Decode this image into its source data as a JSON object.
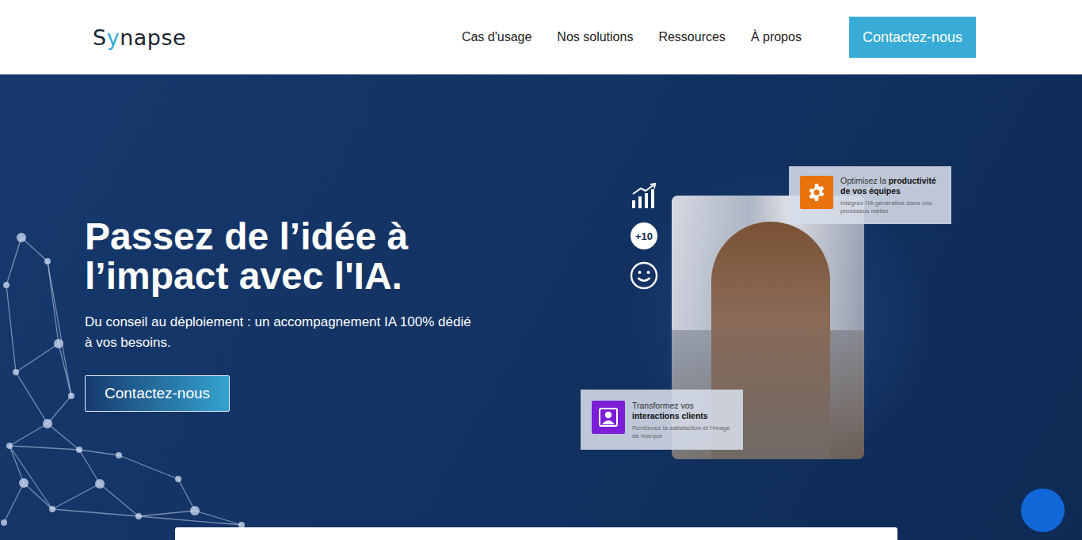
{
  "header": {
    "logo": "Synapse",
    "nav": [
      {
        "label": "Cas d'usage"
      },
      {
        "label": "Nos solutions"
      },
      {
        "label": "Ressources"
      },
      {
        "label": "À propos"
      }
    ],
    "cta": "Contactez-nous"
  },
  "hero": {
    "title_lines": [
      "Passez de l’idée à",
      "l’impact avec l'IA."
    ],
    "subtitle": "Du conseil au déploiement : un accompagnement IA 100% dédié à vos besoins.",
    "cta": "Contactez-nous"
  },
  "visual": {
    "side_icons": [
      {
        "kind": "chart"
      },
      {
        "kind": "badge",
        "text": "+10"
      },
      {
        "kind": "smiley"
      }
    ],
    "cards": [
      {
        "kind": "gear",
        "title": "Optimisez la",
        "title_bold": "productivité de vos équipes",
        "subtitle": "Intégrez l'IA générative dans vos processus métier",
        "color": "#e8730c"
      },
      {
        "kind": "person",
        "title": "Transformez vos",
        "title_bold": "interactions clients",
        "subtitle": "Renforcez la satisfaction et l'image de marque",
        "color": "#7a1fd6"
      }
    ]
  }
}
